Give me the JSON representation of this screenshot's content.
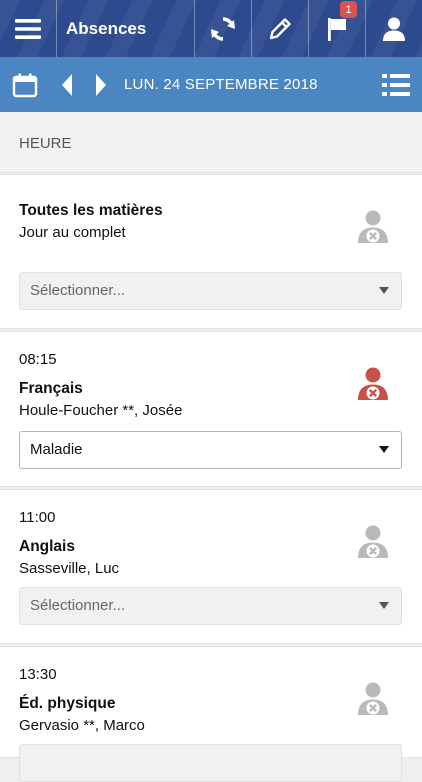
{
  "header": {
    "title": "Absences",
    "notification_count": "1"
  },
  "datebar": {
    "date": "LUN. 24 SEPTEMBRE 2018"
  },
  "section": {
    "heading": "HEURE"
  },
  "cards": [
    {
      "time": "",
      "subject": "Toutes les matières",
      "subtitle": "Jour au complet",
      "status": "none",
      "select": "Sélectionner..."
    },
    {
      "time": "08:15",
      "subject": "Français",
      "subtitle": "Houle-Foucher **, Josée",
      "status": "absent",
      "select": "Maladie"
    },
    {
      "time": "11:00",
      "subject": "Anglais",
      "subtitle": "Sasseville, Luc",
      "status": "none",
      "select": "Sélectionner..."
    },
    {
      "time": "13:30",
      "subject": "Éd. physique",
      "subtitle": "Gervasio **, Marco",
      "status": "none",
      "select": ""
    }
  ],
  "colors": {
    "header_bg": "#2d4a8e",
    "datebar_bg": "#4c86c2",
    "absent_red": "#c9514a",
    "neutral_gray": "#b9b9b9"
  }
}
